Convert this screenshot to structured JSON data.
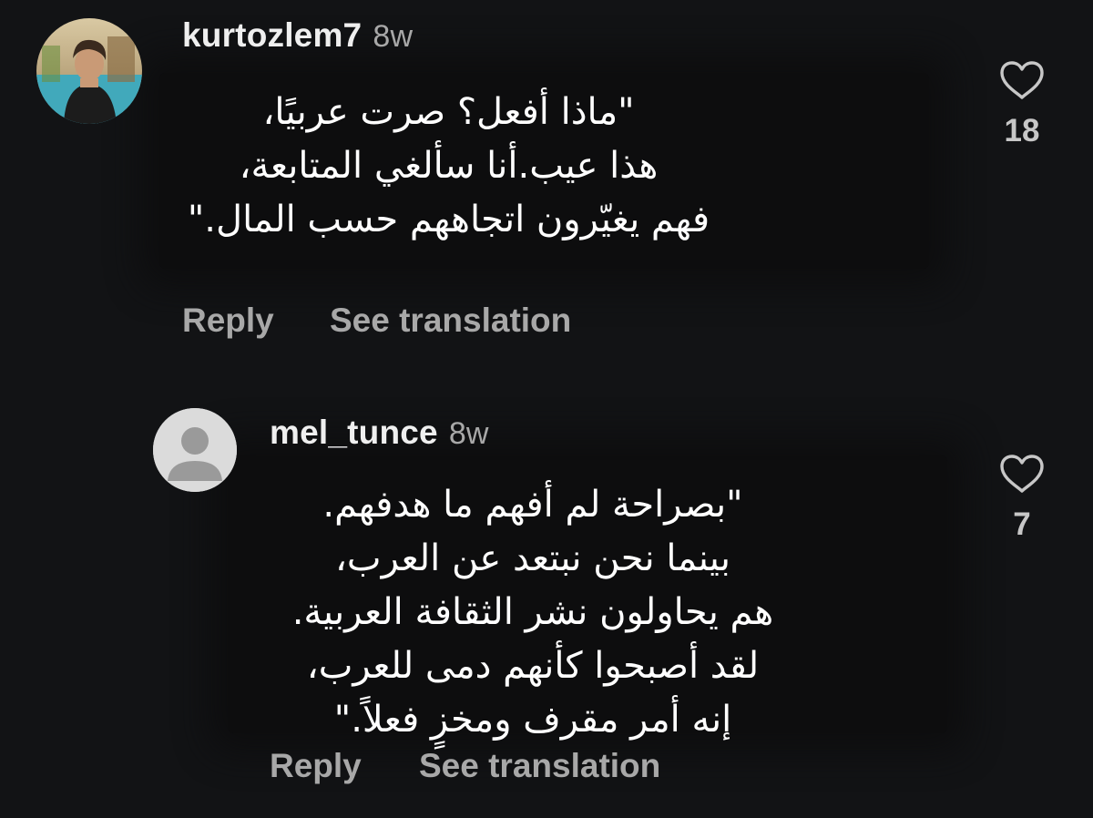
{
  "comments": [
    {
      "username": "kurtozlem7",
      "time": "8w",
      "lines": [
        "\"ماذا أفعل؟ صرت عربيًا،",
        "هذا عيب.أنا سألغي المتابعة،",
        "فهم يغيّرون اتجاههم حسب المال.\""
      ],
      "reply_label": "Reply",
      "translate_label": "See translation",
      "likes": "18",
      "avatar": "profile-photo"
    },
    {
      "username": "mel_tunce",
      "time": "8w",
      "lines": [
        "\"بصراحة لم أفهم ما هدفهم.",
        "بينما نحن نبتعد عن العرب،",
        "هم يحاولون نشر الثقافة العربية.",
        "لقد أصبحوا كأنهم دمى للعرب،",
        "إنه أمر مقرف ومخزٍ فعلاً.\""
      ],
      "reply_label": "Reply",
      "translate_label": "See translation",
      "likes": "7",
      "avatar": "default-avatar"
    }
  ],
  "colors": {
    "background": "#121315",
    "text_primary": "#ffffff",
    "text_secondary": "#a8a8a8",
    "heart_outline": "#c7c7c7"
  }
}
